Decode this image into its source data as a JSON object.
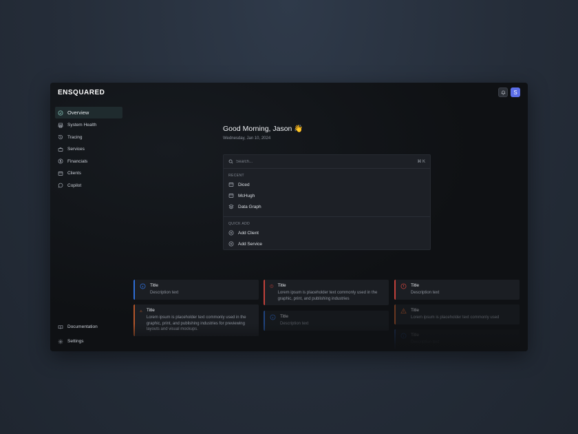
{
  "app": {
    "logo": "ENSQUARED",
    "avatar_initial": "S"
  },
  "sidebar": {
    "items": [
      {
        "label": "Overview",
        "icon": "dashboard-icon",
        "active": true
      },
      {
        "label": "System Health",
        "icon": "printer-icon"
      },
      {
        "label": "Tracing",
        "icon": "history-icon"
      },
      {
        "label": "Services",
        "icon": "briefcase-icon"
      },
      {
        "label": "Financials",
        "icon": "dollar-icon"
      },
      {
        "label": "Clients",
        "icon": "window-icon"
      },
      {
        "label": "Copilot",
        "icon": "chat-icon"
      }
    ],
    "bottom": [
      {
        "label": "Documentation",
        "icon": "book-icon"
      },
      {
        "label": "Settings",
        "icon": "gear-icon"
      }
    ]
  },
  "main": {
    "greeting": "Good Morning, Jason 👋",
    "date": "Wednesday, Jan 10, 2024"
  },
  "search": {
    "placeholder": "Search...",
    "shortcut": "⌘ K",
    "recent_label": "RECENT",
    "recent": [
      {
        "label": "Diced",
        "icon": "window-icon"
      },
      {
        "label": "McHugh",
        "icon": "window-icon"
      },
      {
        "label": "Data Graph",
        "icon": "layers-icon"
      }
    ],
    "quick_add_label": "QUICK ADD",
    "quick_add": [
      {
        "label": "Add Client",
        "icon": "plus-circle-icon"
      },
      {
        "label": "Add Service",
        "icon": "plus-circle-icon"
      }
    ]
  },
  "cards": [
    {
      "title": "Title",
      "desc": "Description text",
      "color": "#2f6fd8",
      "icon": "info-icon"
    },
    {
      "title": "Title",
      "desc": "Lorem ipsum is placeholder text commonly used in the graphic, print, and publishing industries",
      "color": "#c2413b",
      "icon": "info-icon"
    },
    {
      "title": "Title",
      "desc": "Description text",
      "color": "#c2413b",
      "icon": "info-icon"
    },
    {
      "title": "Title",
      "desc": "Lorem ipsum is placeholder text commonly used in the graphic, print, and publishing industries for previewing layouts and visual mockups.",
      "color": "#b4562a",
      "icon": "warning-icon"
    },
    {
      "title": "Title",
      "desc": "Description text",
      "color": "#2f6fd8",
      "icon": "info-icon"
    },
    {
      "title": "Title",
      "desc": "Lorem ipsum is placeholder text commonly used",
      "color": "#b4562a",
      "icon": "warning-icon"
    },
    {
      "title": "Title",
      "desc": "Description text",
      "color": "#2f6fd8",
      "icon": "info-icon"
    }
  ],
  "colors": {
    "accent": "#5b6ee8",
    "info": "#2f6fd8",
    "error": "#c2413b",
    "warning": "#b4562a",
    "active_nav_bg": "#1f2b2e"
  }
}
